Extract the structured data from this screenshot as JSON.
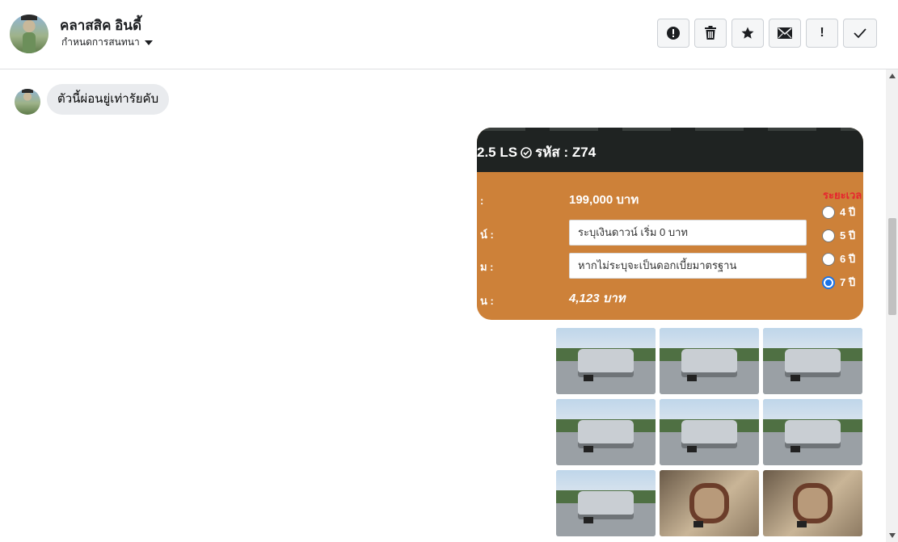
{
  "header": {
    "name": "คลาสสิค อินดี้",
    "subtitle": "กำหนดการสนทนา",
    "toolbar": [
      {
        "icon": "alert-circle-icon"
      },
      {
        "icon": "trash-icon"
      },
      {
        "icon": "star-icon"
      },
      {
        "icon": "mail-icon"
      },
      {
        "icon": "exclamation-icon",
        "text": "!"
      },
      {
        "icon": "check-icon"
      }
    ]
  },
  "conversation": {
    "incoming_message": "ตัวนี้ผ่อนยู่เท่ารัยคับ",
    "card": {
      "title": "2.5 LS ",
      "code": "รหัส : Z74",
      "price_label": ":",
      "price": "199,000 บาท",
      "down_label": "น์ :",
      "down_placeholder": "ระบุเงินดาวน์ เริ่ม 0 บาท",
      "interest_label": "ม :",
      "interest_placeholder": "หากไม่ระบุจะเป็นดอกเบี้ยมาตรฐาน",
      "monthly_label": "น :",
      "monthly": "4,123 บาท",
      "period_title": "ระยะเวล",
      "periods": [
        "4 ปี",
        "5 ปี",
        "6 ปี",
        "7 ปี"
      ],
      "selected_period": "7 ปี"
    },
    "photos_count": 9
  },
  "colors": {
    "card_orange": "#cd8139",
    "card_header": "#1f2322",
    "radio_selected": "#1a73e8",
    "period_title": "#e6262f"
  }
}
